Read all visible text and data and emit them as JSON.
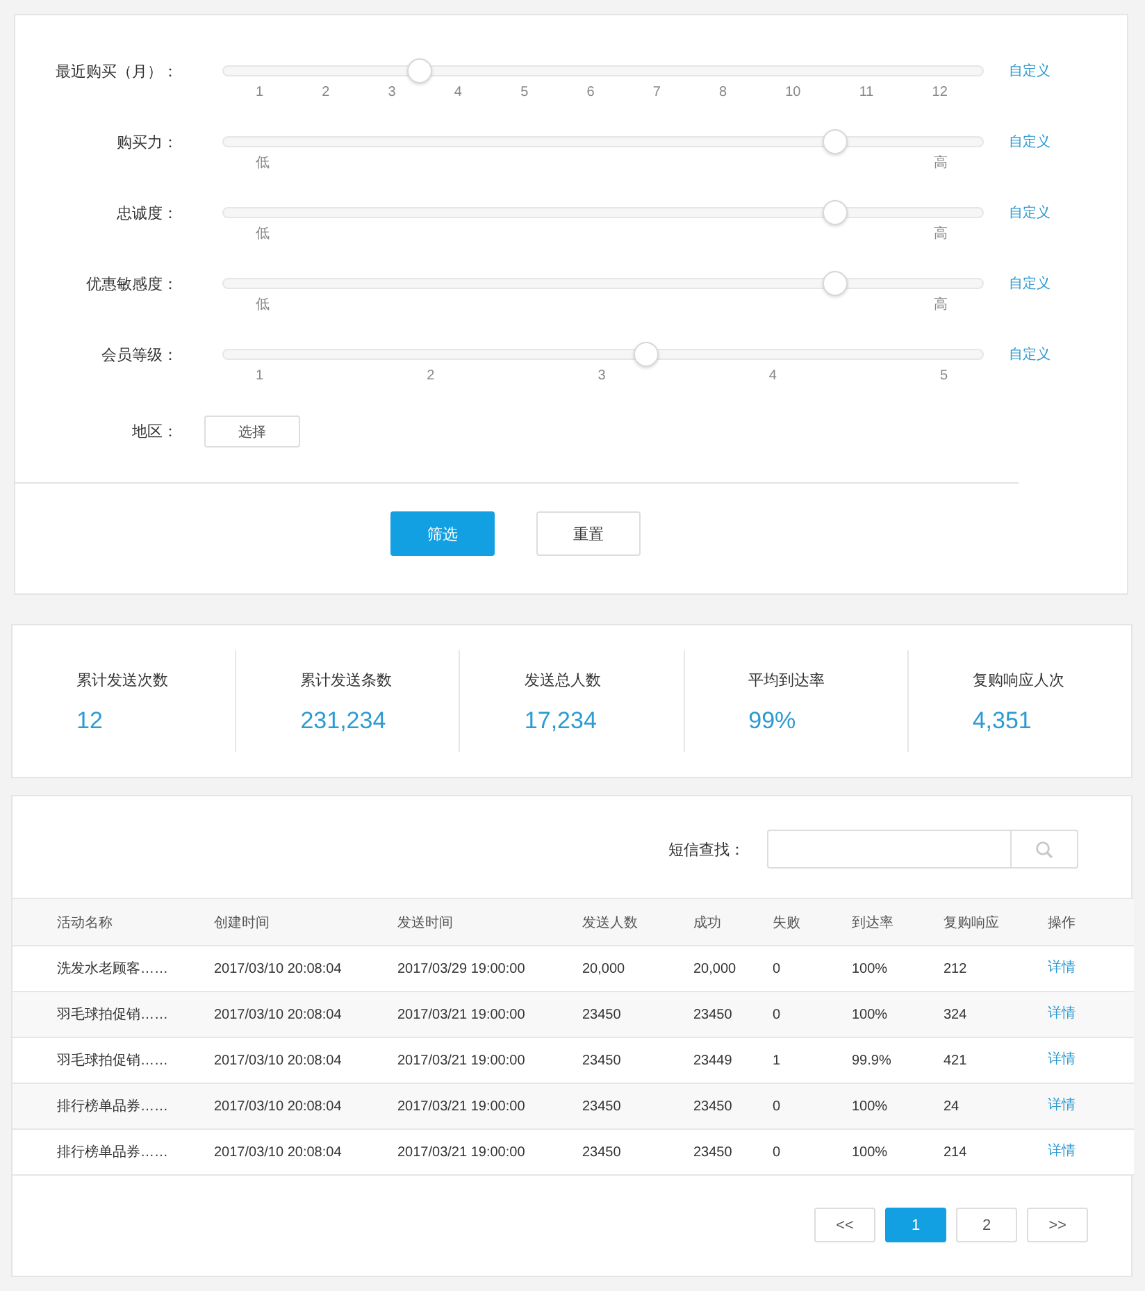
{
  "filters": {
    "sliders": [
      {
        "label": "最近购买（月）：",
        "level": 0.26,
        "ticks": [
          "1",
          "2",
          "3",
          "4",
          "5",
          "6",
          "7",
          "8",
          "10",
          "11",
          "12"
        ],
        "link": "自定义"
      },
      {
        "label": "购买力：",
        "level": 0.805,
        "ticks": [
          "低",
          "高"
        ],
        "link": "自定义"
      },
      {
        "label": "忠诚度：",
        "level": 0.805,
        "ticks": [
          "低",
          "高"
        ],
        "link": "自定义"
      },
      {
        "label": "优惠敏感度：",
        "level": 0.805,
        "ticks": [
          "低",
          "高"
        ],
        "link": "自定义"
      },
      {
        "label": "会员等级：",
        "level": 0.556,
        "ticks": [
          "1",
          "2",
          "3",
          "4",
          "5"
        ],
        "link": "自定义"
      }
    ],
    "region": {
      "label": "地区：",
      "button": "选择"
    },
    "buttons": [
      {
        "label": "筛选",
        "kind": "primary"
      },
      {
        "label": "重置",
        "kind": "default"
      }
    ]
  },
  "stats": [
    {
      "label": "累计发送次数",
      "value": "12"
    },
    {
      "label": "累计发送条数",
      "value": "231,234"
    },
    {
      "label": "发送总人数",
      "value": "17,234"
    },
    {
      "label": "平均到达率",
      "value": "99%"
    },
    {
      "label": "复购响应人次",
      "value": "4,351"
    }
  ],
  "search": {
    "label": "短信查找："
  },
  "table": {
    "columns": [
      "活动名称",
      "创建时间",
      "发送时间",
      "发送人数",
      "成功",
      "失败",
      "到达率",
      "复购响应",
      "操作"
    ],
    "rows": [
      [
        "洗发水老顾客……",
        "2017/03/10 20:08:04",
        "2017/03/29 19:00:00",
        "20,000",
        "20,000",
        "0",
        "100%",
        "212",
        "详情"
      ],
      [
        "羽毛球拍促销……",
        "2017/03/10 20:08:04",
        "2017/03/21 19:00:00",
        "23450",
        "23450",
        "0",
        "100%",
        "324",
        "详情"
      ],
      [
        "羽毛球拍促销……",
        "2017/03/10 20:08:04",
        "2017/03/21 19:00:00",
        "23450",
        "23449",
        "1",
        "99.9%",
        "421",
        "详情"
      ],
      [
        "排行榜单品券……",
        "2017/03/10 20:08:04",
        "2017/03/21 19:00:00",
        "23450",
        "23450",
        "0",
        "100%",
        "24",
        "详情"
      ],
      [
        "排行榜单品券……",
        "2017/03/10 20:08:04",
        "2017/03/21 19:00:00",
        "23450",
        "23450",
        "0",
        "100%",
        "214",
        "详情"
      ]
    ]
  },
  "pagination": {
    "prev": "<<",
    "pages": [
      {
        "label": "1",
        "selected": true
      },
      {
        "label": "2",
        "selected": false
      }
    ],
    "next": ">>"
  }
}
